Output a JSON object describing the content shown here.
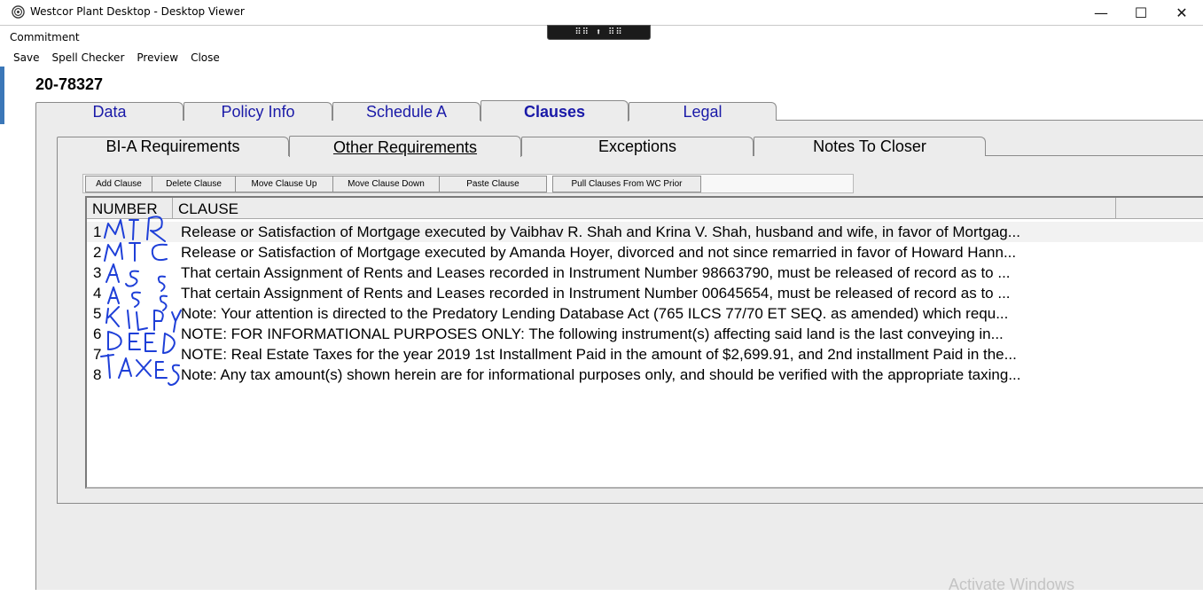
{
  "window": {
    "title": "Westcor Plant Desktop - Desktop Viewer",
    "minimize_glyph": "—",
    "maximize_glyph": "☐",
    "close_glyph": "✕",
    "remote_toolbar_glyph": "⠿⠿ ⬆ ⠿⠿"
  },
  "form_title": "Commitment",
  "menu": [
    "Save",
    "Spell Checker",
    "Preview",
    "Close"
  ],
  "file_number": "20-78327",
  "main_tabs": [
    {
      "label": "Data",
      "active": false
    },
    {
      "label": "Policy Info",
      "active": false
    },
    {
      "label": "Schedule A",
      "active": false
    },
    {
      "label": "Clauses",
      "active": true
    },
    {
      "label": "Legal",
      "active": false
    }
  ],
  "sub_tabs": [
    {
      "label": "BI-A Requirements",
      "active": false
    },
    {
      "label": "Other Requirements",
      "active": true
    },
    {
      "label": "Exceptions",
      "active": false
    },
    {
      "label": "Notes To Closer",
      "active": false
    }
  ],
  "clause_toolbar": [
    "Add Clause",
    "Delete Clause",
    "Move Clause Up",
    "Move Clause Down",
    "Paste Clause",
    "Pull Clauses From WC Prior"
  ],
  "table": {
    "headers": [
      "NUMBER",
      "CLAUSE"
    ],
    "rows": [
      {
        "number": "1",
        "clause": "Release or Satisfaction of Mortgage executed by Vaibhav R. Shah and Krina V. Shah, husband and wife, in favor of Mortgag..."
      },
      {
        "number": "2",
        "clause": "Release or Satisfaction of Mortgage executed by Amanda Hoyer, divorced and not since remarried in favor of Howard Hann..."
      },
      {
        "number": "3",
        "clause": "That certain Assignment of Rents and Leases recorded in Instrument Number 98663790, must be released of record as to ..."
      },
      {
        "number": "4",
        "clause": "That certain Assignment of Rents and Leases recorded in Instrument Number 00645654, must be released of record as to ..."
      },
      {
        "number": "5",
        "clause": "Note:  Your attention is directed to the Predatory Lending Database Act (765 ILCS 77/70 ET SEQ. as amended) which requ..."
      },
      {
        "number": "6",
        "clause": "NOTE:  FOR INFORMATIONAL PURPOSES ONLY: The following instrument(s) affecting said land is the last conveying in..."
      },
      {
        "number": "7",
        "clause": "NOTE: Real Estate Taxes for the year 2019 1st Installment Paid in the amount of $2,699.91, and 2nd installment Paid in the..."
      },
      {
        "number": "8",
        "clause": "Note: Any tax amount(s) shown herein are for informational purposes only, and should be verified with the appropriate taxing..."
      }
    ]
  },
  "handwriting_annotations": [
    "MTR",
    "MTG",
    "ASS",
    "ASS",
    "KILPY",
    "DEED",
    "TAXES"
  ],
  "watermark": "Activate Windows",
  "colors": {
    "tab_text": "#1a1aa8",
    "handwriting": "#1e3fd8",
    "panel": "#ececec"
  }
}
